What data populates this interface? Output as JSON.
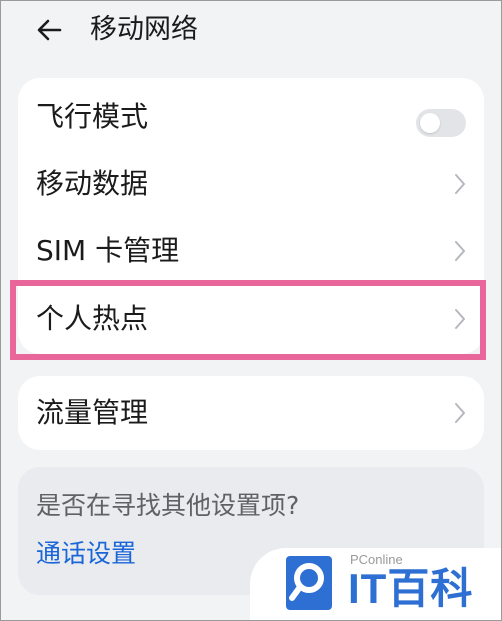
{
  "header": {
    "title": "移动网络",
    "back_icon": "arrow-left-icon"
  },
  "network_settings": {
    "items": [
      {
        "label": "飞行模式",
        "control": "toggle",
        "toggle_on": false
      },
      {
        "label": "移动数据",
        "control": "chevron"
      },
      {
        "label": "SIM 卡管理",
        "control": "chevron"
      },
      {
        "label": "个人热点",
        "control": "chevron",
        "highlighted": true
      }
    ]
  },
  "data_settings": {
    "items": [
      {
        "label": "流量管理",
        "control": "chevron"
      }
    ]
  },
  "suggestions": {
    "title": "是否在寻找其他设置项?",
    "link": "通话设置"
  },
  "watermark": {
    "small": "PConline",
    "brand": "IT百科"
  },
  "colors": {
    "background": "#f1f3f5",
    "card": "#ffffff",
    "highlight": "#e8669a",
    "link": "#1a66d9",
    "watermark": "#2d6fd2"
  }
}
